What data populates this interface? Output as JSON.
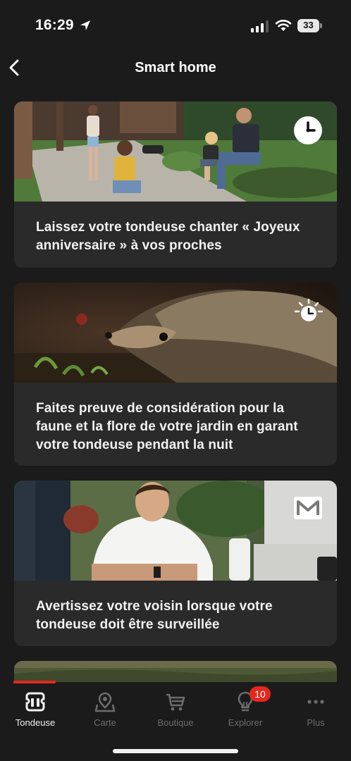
{
  "status_bar": {
    "time": "16:29",
    "battery": "33"
  },
  "header": {
    "title": "Smart home"
  },
  "cards": [
    {
      "text": "Laissez votre tondeuse chanter «  Joyeux anniversaire  » à vos proches",
      "icon": "clock-icon"
    },
    {
      "text": "Faites preuve de considération pour la faune et la flore de votre jardin en garant votre tondeuse pendant la nuit",
      "icon": "night-clock-icon"
    },
    {
      "text": "Avertissez votre voisin lorsque votre tondeuse doit être surveillée",
      "icon": "mail-icon"
    }
  ],
  "tabbar": {
    "tabs": [
      {
        "label": "Tondeuse",
        "icon": "mower-icon",
        "active": true
      },
      {
        "label": "Carte",
        "icon": "map-pin-icon",
        "active": false
      },
      {
        "label": "Boutique",
        "icon": "cart-icon",
        "active": false
      },
      {
        "label": "Explorer",
        "icon": "lightbulb-icon",
        "active": false,
        "badge": "10"
      },
      {
        "label": "Plus",
        "icon": "more-dots-icon",
        "active": false
      }
    ]
  },
  "colors": {
    "background": "#1b1b1b",
    "card": "#2a2a2a",
    "accent": "#e4281e"
  }
}
